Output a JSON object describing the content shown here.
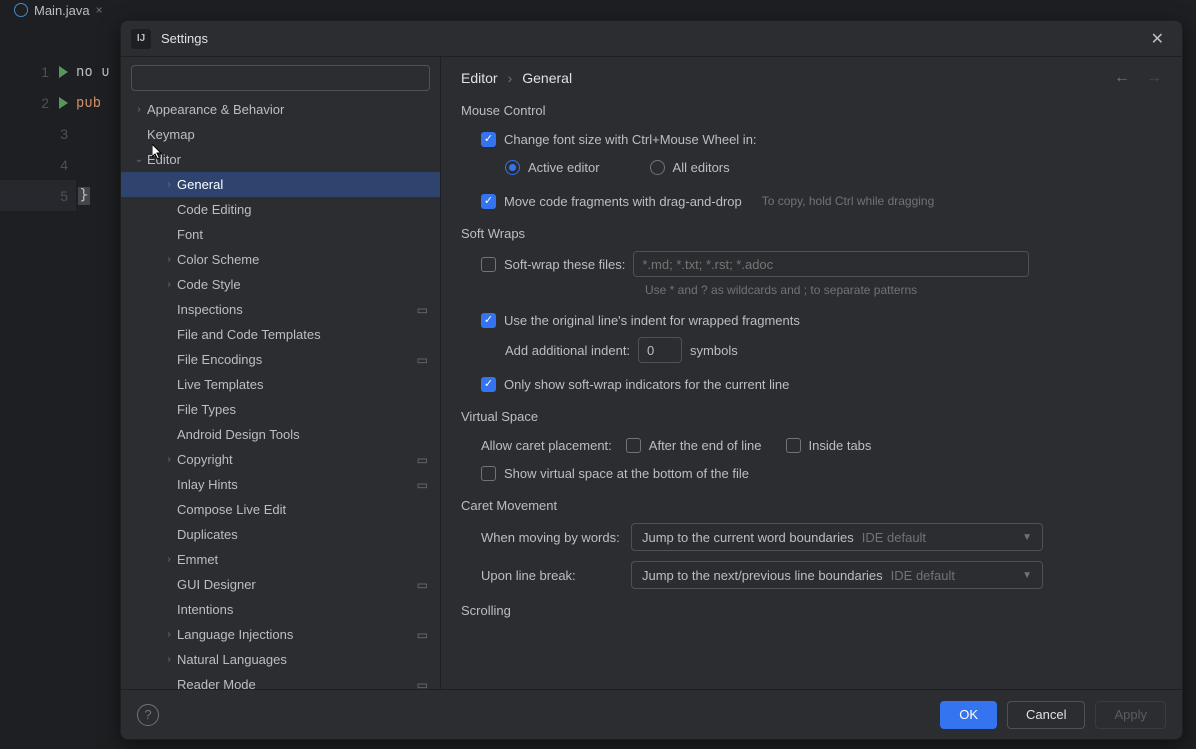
{
  "editor": {
    "tab_name": "Main.java",
    "line1": "no u",
    "line2": "pub",
    "line5_brace": "}"
  },
  "dialog": {
    "title": "Settings",
    "search_placeholder": "",
    "breadcrumb": {
      "root": "Editor",
      "leaf": "General"
    }
  },
  "tree": {
    "items": [
      {
        "label": "Appearance & Behavior",
        "level": 0,
        "arrow": "right",
        "gear": false
      },
      {
        "label": "Keymap",
        "level": 0,
        "arrow": "none",
        "gear": false
      },
      {
        "label": "Editor",
        "level": 0,
        "arrow": "down",
        "gear": false
      },
      {
        "label": "General",
        "level": 1,
        "arrow": "right",
        "gear": false,
        "selected": true
      },
      {
        "label": "Code Editing",
        "level": 1,
        "arrow": "none",
        "gear": false
      },
      {
        "label": "Font",
        "level": 1,
        "arrow": "none",
        "gear": false
      },
      {
        "label": "Color Scheme",
        "level": 1,
        "arrow": "right",
        "gear": false
      },
      {
        "label": "Code Style",
        "level": 1,
        "arrow": "right",
        "gear": false
      },
      {
        "label": "Inspections",
        "level": 1,
        "arrow": "none",
        "gear": true
      },
      {
        "label": "File and Code Templates",
        "level": 1,
        "arrow": "none",
        "gear": false
      },
      {
        "label": "File Encodings",
        "level": 1,
        "arrow": "none",
        "gear": true
      },
      {
        "label": "Live Templates",
        "level": 1,
        "arrow": "none",
        "gear": false
      },
      {
        "label": "File Types",
        "level": 1,
        "arrow": "none",
        "gear": false
      },
      {
        "label": "Android Design Tools",
        "level": 1,
        "arrow": "none",
        "gear": false
      },
      {
        "label": "Copyright",
        "level": 1,
        "arrow": "right",
        "gear": true
      },
      {
        "label": "Inlay Hints",
        "level": 1,
        "arrow": "none",
        "gear": true
      },
      {
        "label": "Compose Live Edit",
        "level": 1,
        "arrow": "none",
        "gear": false
      },
      {
        "label": "Duplicates",
        "level": 1,
        "arrow": "none",
        "gear": false
      },
      {
        "label": "Emmet",
        "level": 1,
        "arrow": "right",
        "gear": false
      },
      {
        "label": "GUI Designer",
        "level": 1,
        "arrow": "none",
        "gear": true
      },
      {
        "label": "Intentions",
        "level": 1,
        "arrow": "none",
        "gear": false
      },
      {
        "label": "Language Injections",
        "level": 1,
        "arrow": "right",
        "gear": true
      },
      {
        "label": "Natural Languages",
        "level": 1,
        "arrow": "right",
        "gear": false
      },
      {
        "label": "Reader Mode",
        "level": 1,
        "arrow": "none",
        "gear": true
      }
    ]
  },
  "sections": {
    "mouse": {
      "title": "Mouse Control",
      "change_font": "Change font size with Ctrl+Mouse Wheel in:",
      "active_editor": "Active editor",
      "all_editors": "All editors",
      "move_drag": "Move code fragments with drag-and-drop",
      "move_drag_hint": "To copy, hold Ctrl while dragging"
    },
    "softwrap": {
      "title": "Soft Wraps",
      "soft_wrap_files": "Soft-wrap these files:",
      "placeholder": "*.md; *.txt; *.rst; *.adoc",
      "wildcard_hint": "Use * and ? as wildcards and ; to separate patterns",
      "use_indent": "Use the original line's indent for wrapped fragments",
      "add_indent_label": "Add additional indent:",
      "add_indent_value": "0",
      "symbols": "symbols",
      "only_current": "Only show soft-wrap indicators for the current line"
    },
    "virtual": {
      "title": "Virtual Space",
      "allow_caret": "Allow caret placement:",
      "after_eol": "After the end of line",
      "inside_tabs": "Inside tabs",
      "show_bottom": "Show virtual space at the bottom of the file"
    },
    "caret": {
      "title": "Caret Movement",
      "by_words": "When moving by words:",
      "by_words_value": "Jump to the current word boundaries",
      "ide_default": "IDE default",
      "line_break": "Upon line break:",
      "line_break_value": "Jump to the next/previous line boundaries"
    },
    "scrolling": {
      "title": "Scrolling"
    }
  },
  "footer": {
    "ok": "OK",
    "cancel": "Cancel",
    "apply": "Apply"
  }
}
